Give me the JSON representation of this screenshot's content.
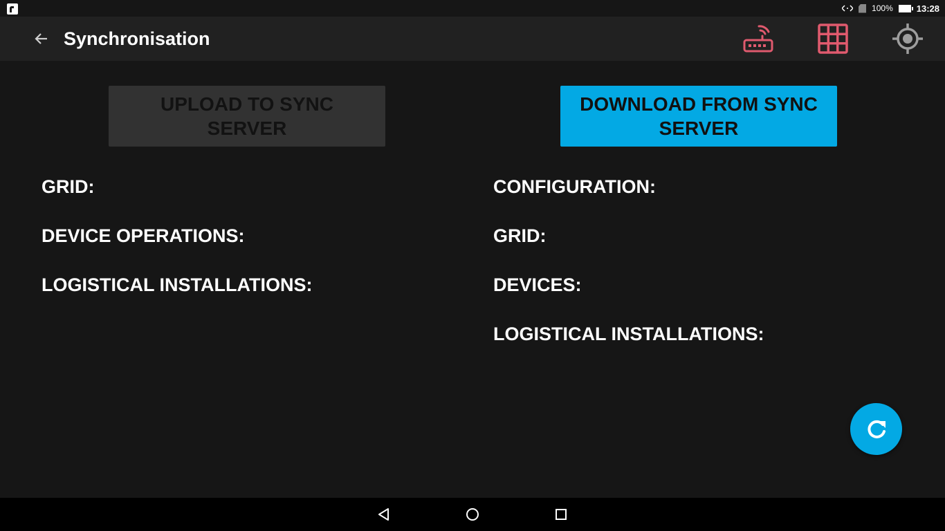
{
  "status_bar": {
    "battery_percent": "100%",
    "time": "13:28",
    "notification_icon": "app-notification-icon",
    "data_icon": "data-arrows-icon",
    "sim_icon": "no-sim-icon",
    "battery_icon": "battery-charging-icon"
  },
  "toolbar": {
    "title": "Synchronisation",
    "back_icon": "arrow-left-icon",
    "actions": [
      "router-icon",
      "grid-icon",
      "crosshair-icon"
    ],
    "action_color": "#e05a6e"
  },
  "left": {
    "button_label": "UPLOAD TO SYNC SERVER",
    "button_enabled": false,
    "labels": [
      "GRID:",
      "DEVICE OPERATIONS:",
      "LOGISTICAL INSTALLATIONS:"
    ]
  },
  "right": {
    "button_label": "DOWNLOAD FROM SYNC SERVER",
    "button_enabled": true,
    "labels": [
      "CONFIGURATION:",
      "GRID:",
      "DEVICES:",
      "LOGISTICAL INSTALLATIONS:"
    ]
  },
  "fab": {
    "icon": "refresh-icon"
  },
  "navbar": {
    "icons": [
      "back-triangle-icon",
      "home-circle-icon",
      "recents-square-icon"
    ]
  },
  "colors": {
    "accent": "#03a9e4",
    "background": "#161616",
    "toolbar": "#212121",
    "disabled_button": "#323232"
  }
}
